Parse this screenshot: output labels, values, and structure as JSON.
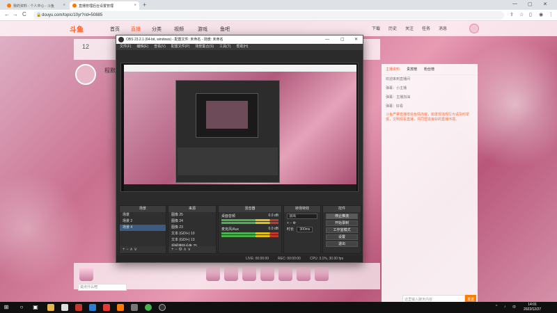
{
  "browser": {
    "tabs": [
      {
        "label": "我的资料 - 个人中心 - 斗鱼",
        "close": "×"
      },
      {
        "label": "直播管理后台设置管理",
        "close": "×"
      }
    ],
    "new_tab": "+",
    "window_controls": [
      "—",
      "▢",
      "✕"
    ],
    "nav": {
      "back": "←",
      "forward": "→",
      "reload": "C",
      "home": "⌂"
    },
    "url": "douyu.com/topic/10yr?rid=50885"
  },
  "site": {
    "logo": "斗鱼",
    "nav": [
      "首页",
      "直播",
      "分类",
      "视频",
      "游戏",
      "鱼吧"
    ],
    "active_nav": "直播",
    "header_right": [
      "下载",
      "历史",
      "关注",
      "任务",
      "消息"
    ],
    "room_number": "12",
    "streamer_name": "程默",
    "sidebar_tabs": [
      "主播资料",
      "贵宾榜",
      "粉丝榜"
    ],
    "chat_lines": [
      "欢迎来到直播间",
      "弹幕：小主播",
      "弹幕：主播加油",
      "弹幕：好看"
    ],
    "notice": "斗鱼严禁直播低俗色情内容，如发现违规行为请及时举报，文明观看直播，共同营造良好的直播环境。",
    "chat_placeholder": "这里输入聊天内容",
    "send_label": "发送",
    "bottom_input": "说点什么吧",
    "theme_color": "#ff5d23"
  },
  "obs": {
    "title": "OBS 23.2.1 (64-bit, windows) - 配置文件: 未命名 - 场景: 未命名",
    "menu": [
      "文件(F)",
      "编辑(E)",
      "查看(V)",
      "配置文件(P)",
      "场景集合(S)",
      "工具(T)",
      "帮助(H)"
    ],
    "docks": {
      "scenes": {
        "title": "场景",
        "items": [
          "场景",
          "场景 2",
          "场景 4"
        ],
        "selected": 2
      },
      "sources": {
        "title": "来源",
        "items": [
          "图像 25",
          "图像 24",
          "图像 23",
          "文本 (GDI+) 10",
          "文本 (GDI+) 13",
          "视频捕获设备 25"
        ]
      },
      "mixer": {
        "title": "混音器",
        "channels": [
          {
            "name": "桌面音频",
            "db": "0.0 dB"
          },
          {
            "name": "麦克风/Aux",
            "db": "0.0 dB"
          }
        ]
      },
      "transitions": {
        "title": "转场特效",
        "type": "淡出",
        "duration_label": "时长",
        "duration": "300ms"
      },
      "controls": {
        "title": "控件",
        "buttons": [
          "停止推流",
          "开始录制",
          "工作室模式",
          "设置",
          "退出"
        ]
      }
    },
    "status": {
      "live": "LIVE: 00:00:00",
      "rec": "REC: 00:00:00",
      "cpu": "CPU: 3.1%, 30.00 fps"
    }
  },
  "taskbar": {
    "start": "⊞",
    "tray": [
      "^",
      "♪",
      "中"
    ],
    "time": "14:01",
    "date": "2022/12/27"
  }
}
